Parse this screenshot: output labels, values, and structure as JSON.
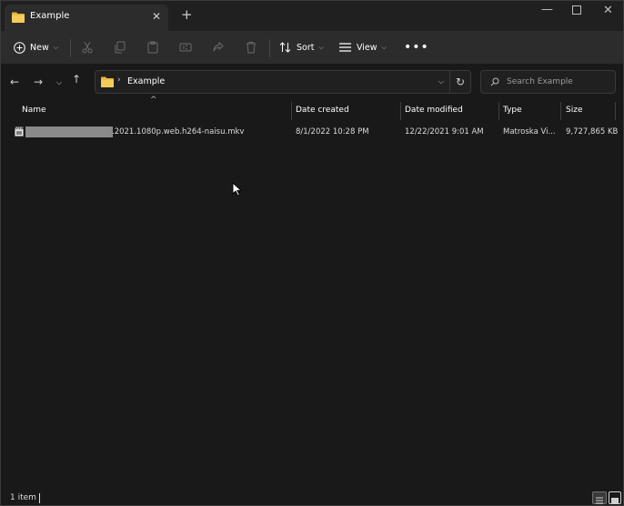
{
  "window": {
    "tab_title": "Example",
    "controls": {
      "minimize": "—",
      "maximize": "□",
      "close": "✕"
    }
  },
  "toolbar": {
    "new_label": "New",
    "sort_label": "Sort",
    "view_label": "View",
    "more_label": "•••"
  },
  "address": {
    "path": "Example",
    "separator": "›"
  },
  "search": {
    "placeholder": "Search Example"
  },
  "columns": {
    "name": "Name",
    "date_created": "Date created",
    "date_modified": "Date modified",
    "type": "Type",
    "size": "Size"
  },
  "files": [
    {
      "name_suffix": ".2021.1080p.web.h264-naisu.mkv",
      "date_created": "8/1/2022 10:28 PM",
      "date_modified": "12/22/2021 9:01 AM",
      "type": "Matroska Vi...",
      "size": "9,727,865 KB"
    }
  ],
  "status": {
    "item_count": "1 item"
  },
  "colors": {
    "background": "#191919",
    "titlebar": "#202020",
    "commandbar": "#2c2c2c",
    "folder_yellow": "#f0c048"
  }
}
